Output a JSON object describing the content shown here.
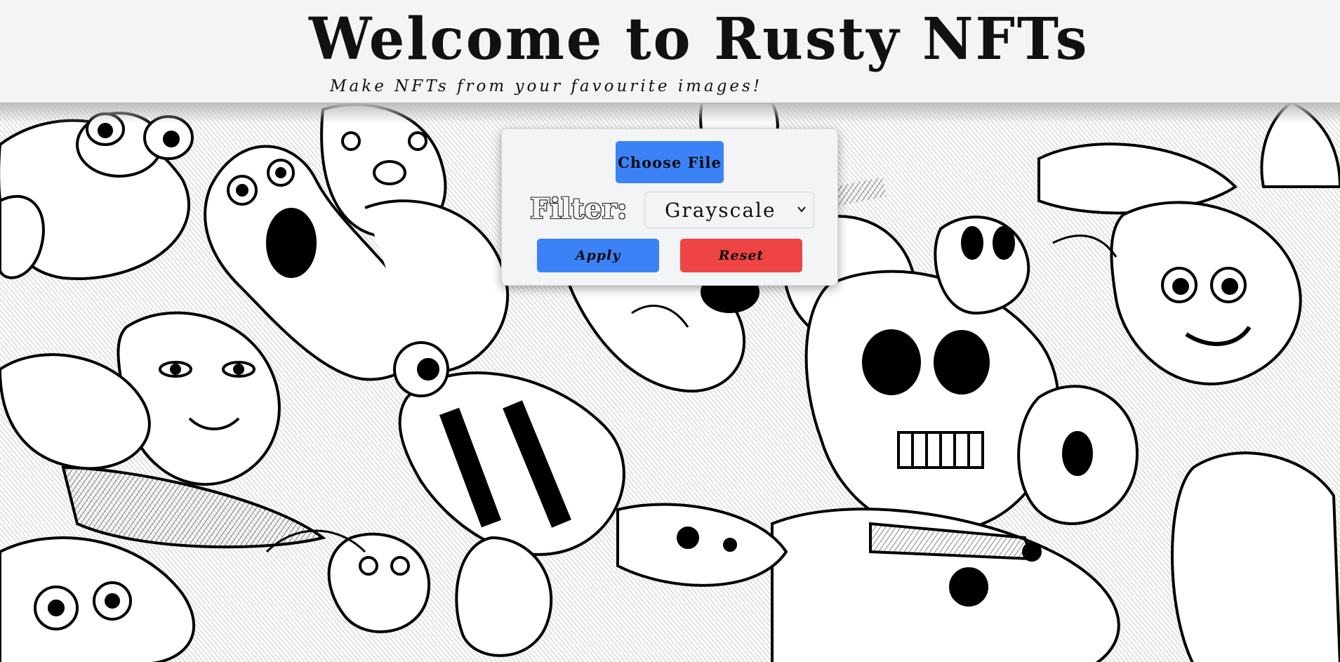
{
  "header": {
    "title": "Welcome to Rusty NFTs",
    "subtitle": "Make NFTs from your favourite images!"
  },
  "controls": {
    "choose_file_label": "Choose File",
    "filter_label": "Filter:",
    "filter_selected": "Grayscale",
    "apply_label": "Apply",
    "reset_label": "Reset"
  },
  "icons": {
    "dropdown": "chevron-down-icon",
    "background": "doodle-illustration"
  },
  "colors": {
    "apply": "#3b82f6",
    "choose_file": "#3b82f6",
    "reset": "#ef4444"
  }
}
